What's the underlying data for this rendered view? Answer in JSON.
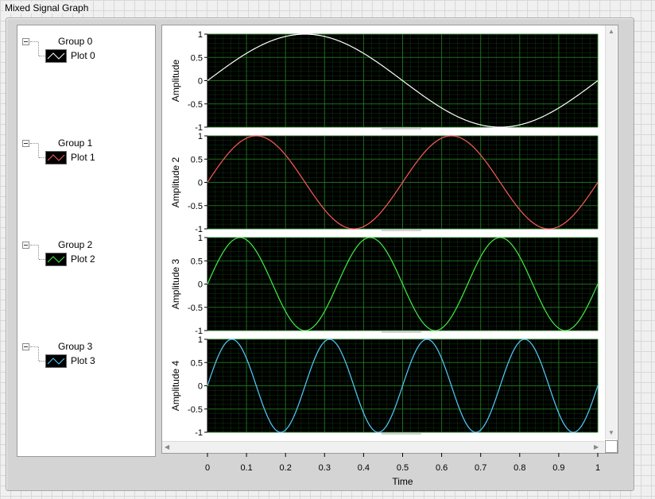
{
  "window": {
    "title": "Mixed Signal Graph"
  },
  "legend": {
    "groups": [
      {
        "label": "Group 0",
        "plot": "Plot 0",
        "color": "#ffffff"
      },
      {
        "label": "Group 1",
        "plot": "Plot 1",
        "color": "#ff5a5a"
      },
      {
        "label": "Group 2",
        "plot": "Plot 2",
        "color": "#44ee44"
      },
      {
        "label": "Group 3",
        "plot": "Plot 3",
        "color": "#55ccff"
      }
    ]
  },
  "chart_data": {
    "type": "line",
    "xlabel": "Time",
    "xlim": [
      0,
      1
    ],
    "x_ticks": [
      "0",
      "0.1",
      "0.2",
      "0.3",
      "0.4",
      "0.5",
      "0.6",
      "0.7",
      "0.8",
      "0.9",
      "1"
    ],
    "y_ticks": [
      "1",
      "0.5",
      "0",
      "-0.5",
      "-1"
    ],
    "grid": true,
    "plot_background": "#000000",
    "grid_color": "#1f7a1f",
    "series": [
      {
        "name": "Plot 0",
        "ylabel": "Amplitude",
        "ylim": [
          -1,
          1
        ],
        "cycles": 1,
        "color": "#ffffff"
      },
      {
        "name": "Plot 1",
        "ylabel": "Amplitude 2",
        "ylim": [
          -1,
          1
        ],
        "cycles": 2,
        "color": "#ff5a5a"
      },
      {
        "name": "Plot 2",
        "ylabel": "Amplitude 3",
        "ylim": [
          -1,
          1
        ],
        "cycles": 3,
        "color": "#44ee44"
      },
      {
        "name": "Plot 3",
        "ylabel": "Amplitude 4",
        "ylim": [
          -1,
          1
        ],
        "cycles": 4,
        "color": "#55ccff"
      }
    ]
  },
  "scrollbars": {
    "up_arrow": "▲",
    "down_arrow": "▼",
    "left_arrow": "◀",
    "right_arrow": "▶"
  }
}
